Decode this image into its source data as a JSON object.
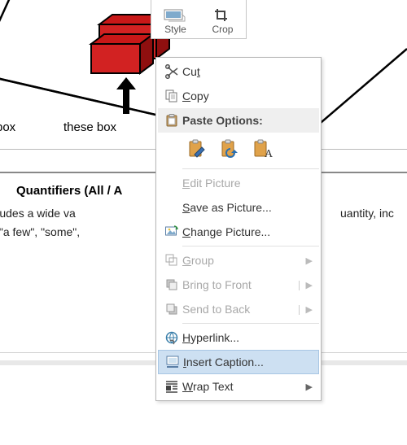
{
  "mini_toolbar": {
    "style_label": "Style",
    "crop_label": "Crop"
  },
  "document": {
    "label_box": "box",
    "label_these_box": "these box",
    "heading": "Quantifiers (All / A",
    "line1": "ers includes a wide va",
    "line1_tail": "uantity, inc",
    "line2": "ough\", \"a few\", \"some\","
  },
  "menu": {
    "cut": "Cut",
    "copy": "Copy",
    "paste_options": "Paste Options:",
    "edit_picture": "Edit Picture",
    "save_as_picture": "Save as Picture...",
    "change_picture": "Change Picture...",
    "group": "Group",
    "bring_to_front": "Bring to Front",
    "send_to_back": "Send to Back",
    "hyperlink": "Hyperlink...",
    "insert_caption": "Insert Caption...",
    "wrap_text": "Wrap Text"
  }
}
